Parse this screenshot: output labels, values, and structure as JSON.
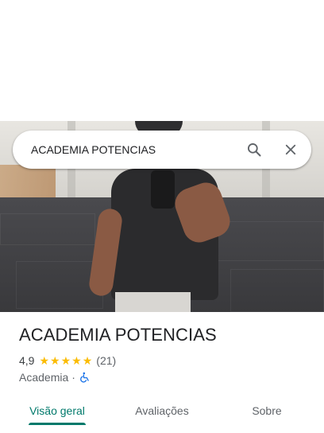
{
  "search": {
    "query": "ACADEMIA POTENCIAS",
    "search_icon": "search-icon",
    "close_icon": "close-icon"
  },
  "place": {
    "name": "ACADEMIA POTENCIAS",
    "rating": "4,9",
    "stars": 5,
    "reviews": "(21)",
    "category": "Academia",
    "separator": "·",
    "accessibility_icon": "wheelchair-icon"
  },
  "tabs": [
    {
      "label": "Visão geral",
      "active": true
    },
    {
      "label": "Avaliações",
      "active": false
    },
    {
      "label": "Sobre",
      "active": false
    }
  ],
  "colors": {
    "accent": "#00796b",
    "star": "#fbbc04",
    "accessibility": "#1a73e8"
  }
}
